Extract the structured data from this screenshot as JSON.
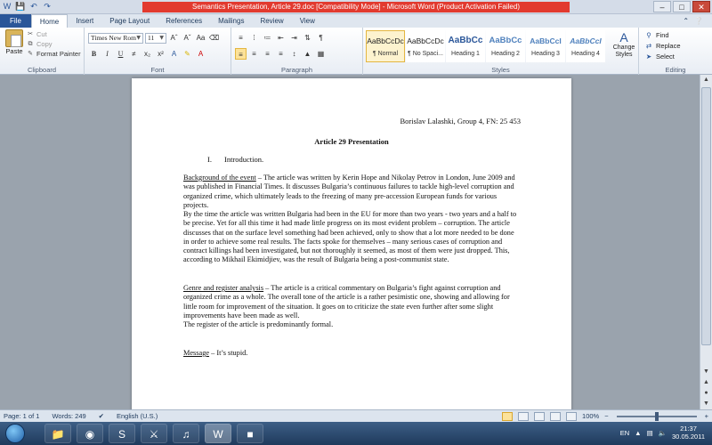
{
  "window": {
    "title": "Semantics Presentation, Article 29.doc [Compatibility Mode] - Microsoft Word (Product Activation Failed)"
  },
  "tabs": [
    {
      "label": "File"
    },
    {
      "label": "Home"
    },
    {
      "label": "Insert"
    },
    {
      "label": "Page Layout"
    },
    {
      "label": "References"
    },
    {
      "label": "Mailings"
    },
    {
      "label": "Review"
    },
    {
      "label": "View"
    }
  ],
  "ribbon": {
    "clipboard": {
      "label": "Clipboard",
      "paste": "Paste",
      "cut": "Cut",
      "copy": "Copy",
      "format_painter": "Format Painter"
    },
    "font": {
      "label": "Font",
      "family": "Times New Rom",
      "size": "11"
    },
    "paragraph": {
      "label": "Paragraph"
    },
    "styles": {
      "label": "Styles",
      "items": [
        {
          "preview": "AaBbCcDc",
          "name": "¶ Normal"
        },
        {
          "preview": "AaBbCcDc",
          "name": "¶ No Spaci..."
        },
        {
          "preview": "AaBbCc",
          "name": "Heading 1"
        },
        {
          "preview": "AaBbCc",
          "name": "Heading 2"
        },
        {
          "preview": "AaBbCcI",
          "name": "Heading 3"
        },
        {
          "preview": "AaBbCcI",
          "name": "Heading 4"
        }
      ],
      "change_styles": "Change Styles"
    },
    "editing": {
      "label": "Editing",
      "find": "Find",
      "replace": "Replace",
      "select": "Select"
    }
  },
  "document": {
    "author_line": "Borislav Lalashki, Group 4, FN: 25 453",
    "title": "Article 29 Presentation",
    "intro_number": "I.",
    "intro_text": "Introduction.",
    "p1_heading": "Background of the event",
    "p1_text": " – The article was written by Kerin Hope and Nikolay Petrov in London, June 2009 and was published in Financial Times. It discusses Bulgaria’s continuous failures to tackle high-level corruption and organized crime, which ultimately leads to the freezing of many pre-accession European funds for various projects.",
    "p2_text": "By the time the article was written Bulgaria had been in the EU for more than two years - two years and a half to be precise. Yet for all this time it had made little progress on its most evident problem – corruption. The article discusses that on the surface level something had been achieved, only to show that a lot more needed to be done in order to achieve some real results. The facts spoke for themselves – many serious cases of corruption and contract killings had been investigated, but not thoroughly it seemed, as most of them were just dropped. This, according to Mikhail Ekimidjiev, was the result of Bulgaria being a post-communist state.",
    "p3_heading": "Genre and register analysis",
    "p3_text": " – The article is a critical commentary on Bulgaria’s fight against corruption and organized crime as a whole. The overall tone of the article is a rather pesimistic one, showing and allowing for little room for improvement of the situation. It goes on to criticize the state even further after some slight improvements have been made as well.",
    "p4_text": "The register of the article is predominantly formal.",
    "p5_heading": "Message",
    "p5_text": " – It’s stupid."
  },
  "status": {
    "page": "Page: 1 of 1",
    "words": "Words: 249",
    "language": "English (U.S.)",
    "zoom": "100%",
    "zoom_value": 100
  },
  "taskbar": {
    "lang": "EN",
    "time": "21:37",
    "date": "30.05.2011"
  }
}
